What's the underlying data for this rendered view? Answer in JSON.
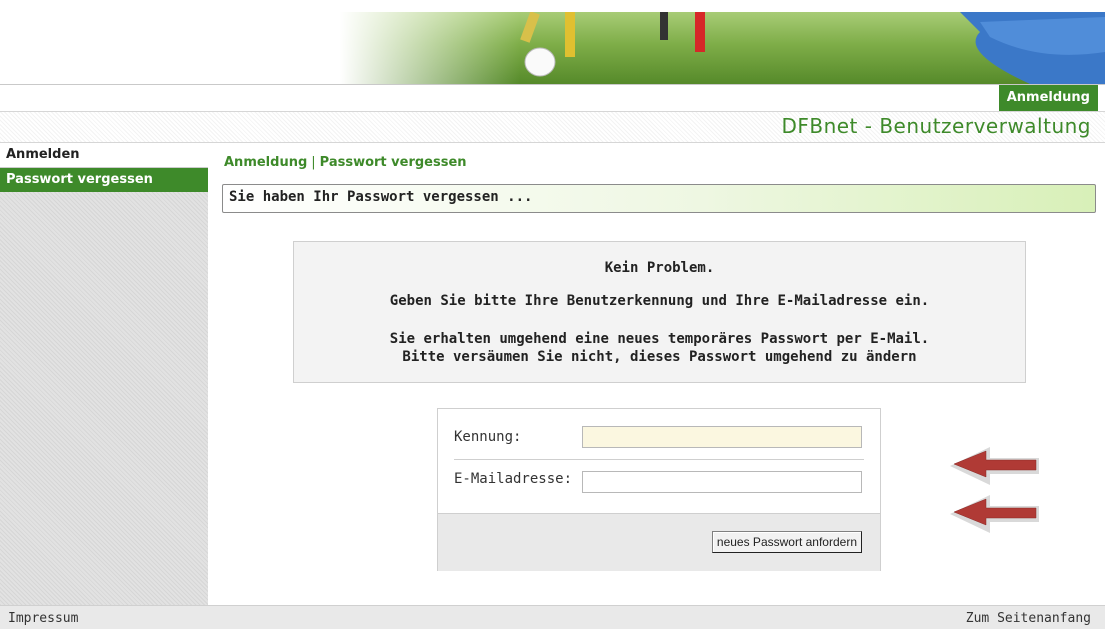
{
  "header": {
    "tab_label": "Anmeldung",
    "app_title": "DFBnet - Benutzerverwaltung"
  },
  "sidebar": {
    "items": [
      {
        "label": "Anmelden"
      },
      {
        "label": "Passwort vergessen"
      }
    ]
  },
  "breadcrumb": {
    "items": [
      "Anmeldung",
      "Passwort vergessen"
    ],
    "separator": "|"
  },
  "section": {
    "title": "Sie haben Ihr Passwort vergessen ..."
  },
  "info": {
    "line1": "Kein Problem.",
    "line2": "Geben Sie bitte Ihre Benutzerkennung und Ihre E-Mailadresse ein.",
    "line3": "Sie erhalten umgehend eine neues temporäres Passwort per E-Mail.",
    "line4": "Bitte versäumen Sie nicht, dieses Passwort umgehend zu ändern"
  },
  "form": {
    "kennung_label": "Kennung:",
    "kennung_value": "",
    "email_label": "E-Mailadresse:",
    "email_value": "",
    "submit_label": "neues Passwort anfordern"
  },
  "footer": {
    "left_link": "Impressum",
    "right_link": "Zum Seitenanfang"
  },
  "colors": {
    "accent": "#3e8a2a",
    "arrow": "#b03a35"
  },
  "icons": {
    "annotation_arrow": "left-arrow-icon"
  }
}
